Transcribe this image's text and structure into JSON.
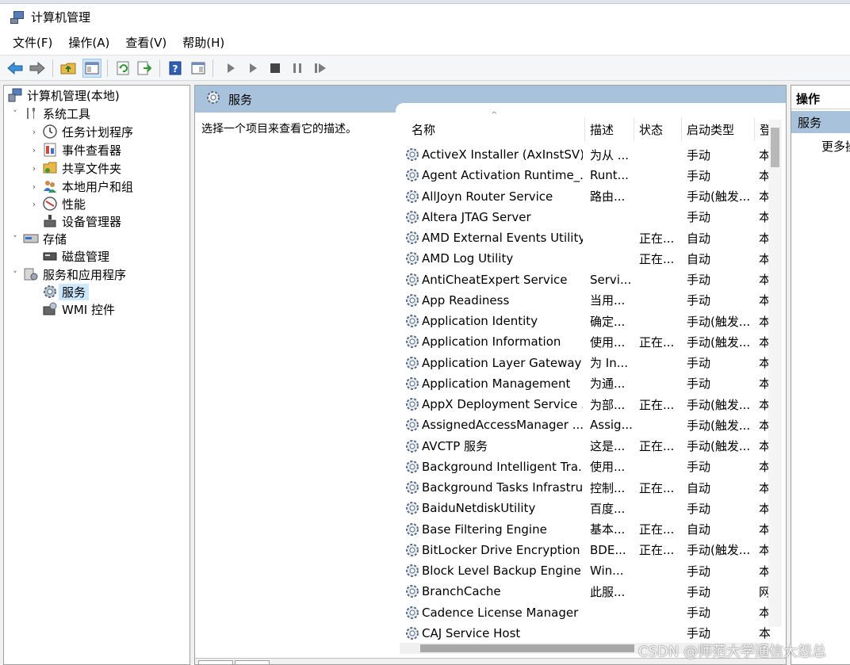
{
  "window": {
    "title": "计算机管理"
  },
  "menu": [
    "文件(F)",
    "操作(A)",
    "查看(V)",
    "帮助(H)"
  ],
  "tree": [
    {
      "label": "计算机管理(本地)",
      "icon": "computer-icon",
      "level": 0,
      "twisty": ""
    },
    {
      "label": "系统工具",
      "icon": "tools-icon",
      "level": 1,
      "twisty": "˅"
    },
    {
      "label": "任务计划程序",
      "icon": "clock-icon",
      "level": 2,
      "twisty": "›"
    },
    {
      "label": "事件查看器",
      "icon": "event-viewer-icon",
      "level": 2,
      "twisty": "›"
    },
    {
      "label": "共享文件夹",
      "icon": "shared-folder-icon",
      "level": 2,
      "twisty": "›"
    },
    {
      "label": "本地用户和组",
      "icon": "users-icon",
      "level": 2,
      "twisty": "›"
    },
    {
      "label": "性能",
      "icon": "performance-icon",
      "level": 2,
      "twisty": "›"
    },
    {
      "label": "设备管理器",
      "icon": "device-manager-icon",
      "level": 2,
      "twisty": ""
    },
    {
      "label": "存储",
      "icon": "storage-icon",
      "level": 1,
      "twisty": "˅"
    },
    {
      "label": "磁盘管理",
      "icon": "disk-icon",
      "level": 2,
      "twisty": ""
    },
    {
      "label": "服务和应用程序",
      "icon": "services-apps-icon",
      "level": 1,
      "twisty": "˅"
    },
    {
      "label": "服务",
      "icon": "gear-icon",
      "level": 2,
      "twisty": "",
      "selected": true
    },
    {
      "label": "WMI 控件",
      "icon": "wmi-icon",
      "level": 2,
      "twisty": ""
    }
  ],
  "center": {
    "title": "服务",
    "description": "选择一个项目来查看它的描述。",
    "columns": [
      "名称",
      "描述",
      "状态",
      "启动类型",
      "登"
    ]
  },
  "services": [
    {
      "name": "ActiveX Installer (AxInstSV)",
      "desc": "为从 ...",
      "status": "",
      "startup": "手动",
      "logon": "本"
    },
    {
      "name": "Agent Activation Runtime_...",
      "desc": "Runt...",
      "status": "",
      "startup": "手动",
      "logon": "本"
    },
    {
      "name": "AllJoyn Router Service",
      "desc": "路由...",
      "status": "",
      "startup": "手动(触发...",
      "logon": "本"
    },
    {
      "name": "Altera JTAG Server",
      "desc": "",
      "status": "",
      "startup": "手动",
      "logon": "本"
    },
    {
      "name": "AMD External Events Utility",
      "desc": "",
      "status": "正在...",
      "startup": "自动",
      "logon": "本"
    },
    {
      "name": "AMD Log Utility",
      "desc": "",
      "status": "正在...",
      "startup": "自动",
      "logon": "本"
    },
    {
      "name": "AntiCheatExpert Service",
      "desc": "Servi...",
      "status": "",
      "startup": "手动",
      "logon": "本"
    },
    {
      "name": "App Readiness",
      "desc": "当用...",
      "status": "",
      "startup": "手动",
      "logon": "本"
    },
    {
      "name": "Application Identity",
      "desc": "确定...",
      "status": "",
      "startup": "手动(触发...",
      "logon": "本"
    },
    {
      "name": "Application Information",
      "desc": "使用...",
      "status": "正在...",
      "startup": "手动(触发...",
      "logon": "本"
    },
    {
      "name": "Application Layer Gateway ...",
      "desc": "为 In...",
      "status": "",
      "startup": "手动",
      "logon": "本"
    },
    {
      "name": "Application Management",
      "desc": "为通...",
      "status": "",
      "startup": "手动",
      "logon": "本"
    },
    {
      "name": "AppX Deployment Service ...",
      "desc": "为部...",
      "status": "正在...",
      "startup": "手动(触发...",
      "logon": "本"
    },
    {
      "name": "AssignedAccessManager ...",
      "desc": "Assig...",
      "status": "",
      "startup": "手动(触发...",
      "logon": "本"
    },
    {
      "name": "AVCTP 服务",
      "desc": "这是...",
      "status": "正在...",
      "startup": "手动(触发...",
      "logon": "本"
    },
    {
      "name": "Background Intelligent Tra...",
      "desc": "使用...",
      "status": "",
      "startup": "手动",
      "logon": "本"
    },
    {
      "name": "Background Tasks Infrastru...",
      "desc": "控制...",
      "status": "正在...",
      "startup": "自动",
      "logon": "本"
    },
    {
      "name": "BaiduNetdiskUtility",
      "desc": "百度...",
      "status": "",
      "startup": "手动",
      "logon": "本"
    },
    {
      "name": "Base Filtering Engine",
      "desc": "基本...",
      "status": "正在...",
      "startup": "自动",
      "logon": "本"
    },
    {
      "name": "BitLocker Drive Encryption ...",
      "desc": "BDE...",
      "status": "正在...",
      "startup": "手动(触发...",
      "logon": "本"
    },
    {
      "name": "Block Level Backup Engine ...",
      "desc": "Win...",
      "status": "",
      "startup": "手动",
      "logon": "本"
    },
    {
      "name": "BranchCache",
      "desc": "此服...",
      "status": "",
      "startup": "手动",
      "logon": "网"
    },
    {
      "name": "Cadence License Manager",
      "desc": "",
      "status": "",
      "startup": "手动",
      "logon": "本"
    },
    {
      "name": "CAJ Service Host",
      "desc": "",
      "status": "",
      "startup": "手动",
      "logon": "本"
    }
  ],
  "actions": {
    "header": "操作",
    "section": "服务",
    "more": "更多操"
  },
  "watermark": "CSDN @师范大学通信大怨总"
}
